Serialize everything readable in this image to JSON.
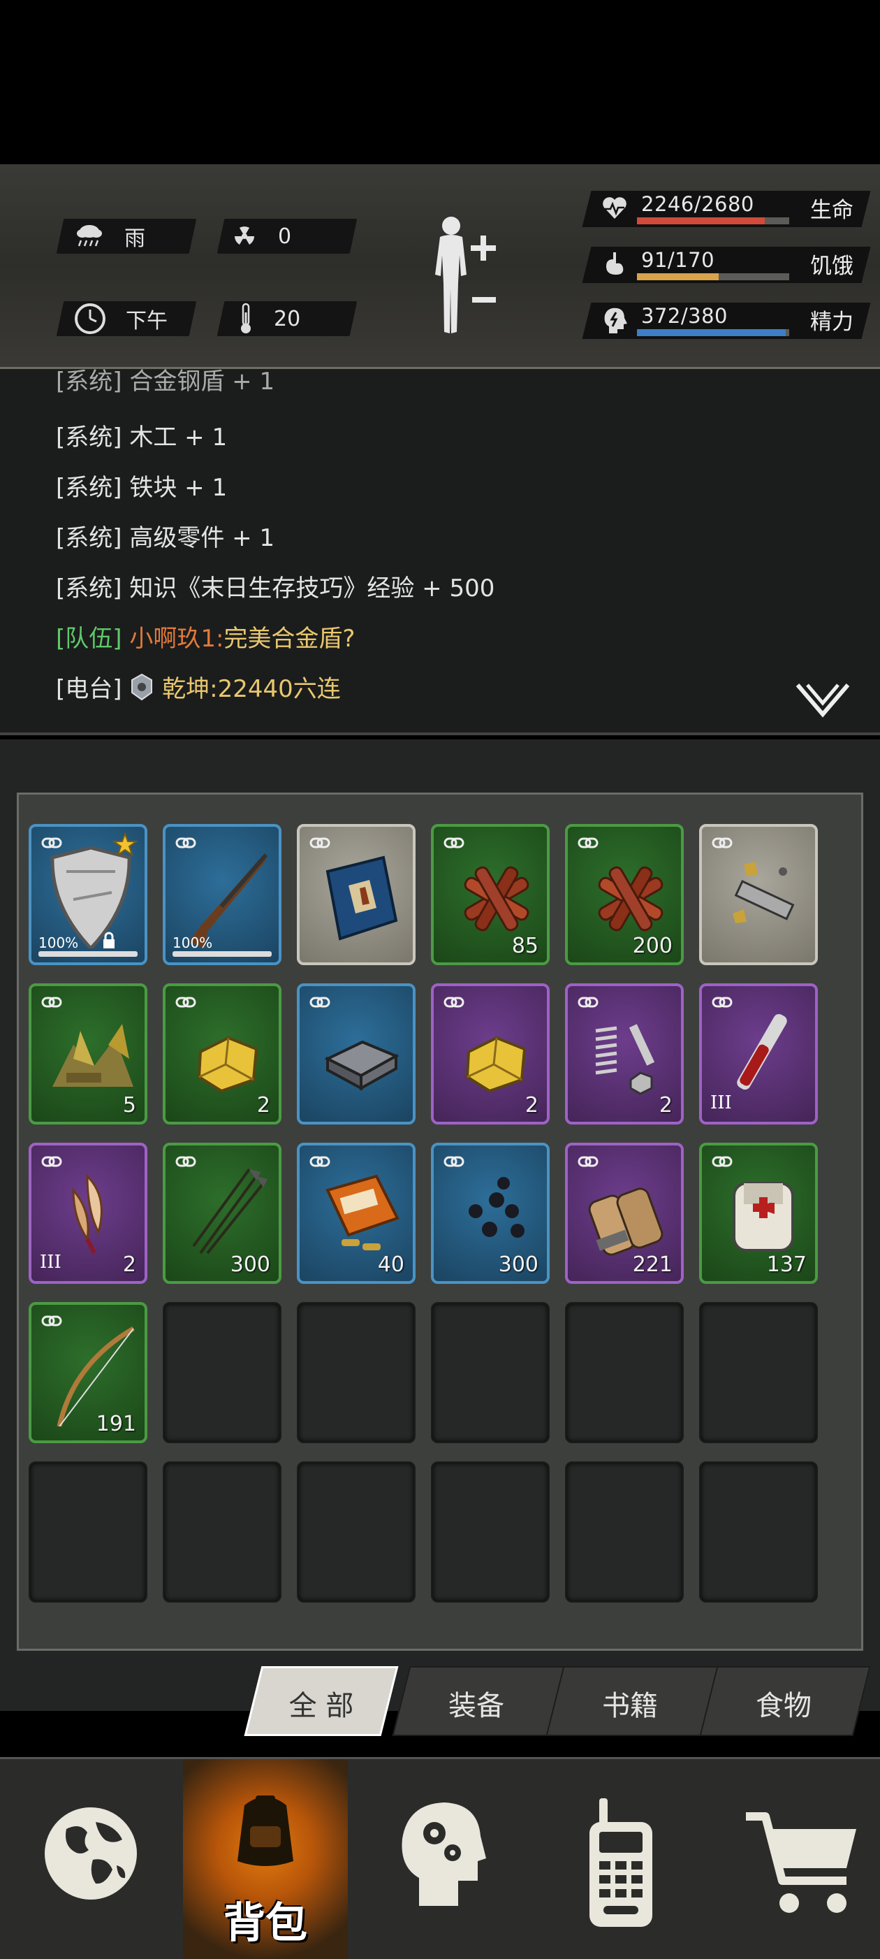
{
  "status": {
    "weather": {
      "label": "雨",
      "icon": "rain-cloud-icon"
    },
    "radiation": {
      "value": "0",
      "icon": "radiation-icon"
    },
    "time": {
      "label": "下午",
      "icon": "clock-icon"
    },
    "temperature": {
      "value": "20",
      "icon": "thermometer-icon"
    },
    "stats": [
      {
        "label": "生命",
        "value": "2246/2680",
        "fraction": 0.838,
        "color": "#d14a3a",
        "icon": "heartbeat-icon"
      },
      {
        "label": "饥饿",
        "value": "91/170",
        "fraction": 0.535,
        "color": "#d9a34a",
        "icon": "stomach-icon"
      },
      {
        "label": "精力",
        "value": "372/380",
        "fraction": 0.979,
        "color": "#3d7fc6",
        "icon": "energy-head-icon"
      }
    ]
  },
  "chat": {
    "lines": [
      {
        "tag": "[系统]",
        "text": "合金钢盾 + 1"
      },
      {
        "tag": "[系统]",
        "text": "木工 + 1"
      },
      {
        "tag": "[系统]",
        "text": "铁块 + 1"
      },
      {
        "tag": "[系统]",
        "text": "高级零件 + 1"
      },
      {
        "tag": "[系统]",
        "text": "知识《末日生存技巧》经验 + 500"
      }
    ],
    "team": {
      "tag": "[队伍]",
      "name": "小啊玖1:",
      "text": "完美合金盾?"
    },
    "radio": {
      "tag": "[电台]",
      "name": "乾坤",
      "text": ":22440六连"
    }
  },
  "inventory": {
    "slots": [
      {
        "rarity": "blue",
        "icon": "alloy-shield-icon",
        "durability": "100%",
        "star": true,
        "locked": true
      },
      {
        "rarity": "blue",
        "icon": "rifle-icon",
        "durability": "100%"
      },
      {
        "rarity": "gray",
        "icon": "survival-book-icon"
      },
      {
        "rarity": "green",
        "icon": "firewood-icon",
        "qty": "85"
      },
      {
        "rarity": "green",
        "icon": "firewood-icon",
        "qty": "200"
      },
      {
        "rarity": "gray",
        "icon": "scrap-metal-icon"
      },
      {
        "rarity": "green",
        "icon": "junk-pile-icon",
        "qty": "5"
      },
      {
        "rarity": "green",
        "icon": "gold-ore-icon",
        "qty": "2"
      },
      {
        "rarity": "blue",
        "icon": "iron-ingot-icon"
      },
      {
        "rarity": "purple",
        "icon": "gold-ore-icon",
        "qty": "2"
      },
      {
        "rarity": "purple",
        "icon": "spring-bolt-parts-icon",
        "qty": "2"
      },
      {
        "rarity": "purple",
        "icon": "blood-vial-icon",
        "tier": "III"
      },
      {
        "rarity": "purple",
        "icon": "feather-icon",
        "qty": "2",
        "tier": "III"
      },
      {
        "rarity": "green",
        "icon": "arrows-icon",
        "qty": "300"
      },
      {
        "rarity": "blue",
        "icon": "ammo-box-icon",
        "qty": "40"
      },
      {
        "rarity": "blue",
        "icon": "iron-balls-icon",
        "qty": "300"
      },
      {
        "rarity": "purple",
        "icon": "shotgun-shells-icon",
        "qty": "221"
      },
      {
        "rarity": "green",
        "icon": "bandage-icon",
        "qty": "137"
      },
      {
        "rarity": "green",
        "icon": "bow-icon",
        "qty": "191"
      }
    ],
    "empty_slots": 11
  },
  "tabs": [
    {
      "label": "全 部",
      "active": true
    },
    {
      "label": "装备"
    },
    {
      "label": "书籍"
    },
    {
      "label": "食物"
    }
  ],
  "nav": [
    {
      "icon": "globe-icon"
    },
    {
      "icon": "backpack-icon",
      "label": "背包",
      "active": true
    },
    {
      "icon": "head-gears-icon"
    },
    {
      "icon": "walkie-talkie-icon"
    },
    {
      "icon": "shopping-cart-icon"
    }
  ],
  "colors": {
    "team_tag": "#5fc86a",
    "team_name": "#e07a3a",
    "team_text": "#e8c76e",
    "radio_name": "#e8c76e"
  }
}
